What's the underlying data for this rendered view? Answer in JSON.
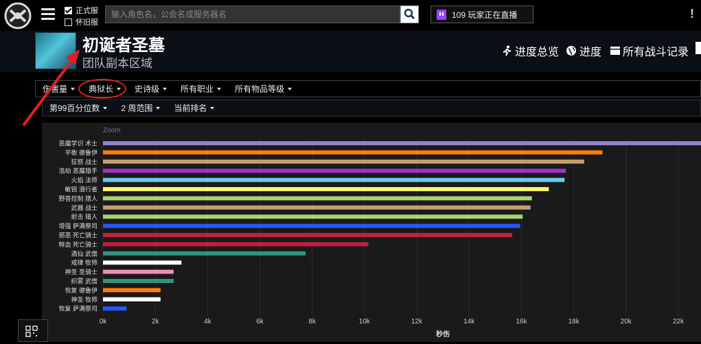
{
  "top": {
    "retail_label": "正式服",
    "classic_label": "怀旧服",
    "search_placeholder": "输入角色名，公会名或服务器名",
    "live_text": "109 玩家正在直播",
    "alert": "!"
  },
  "zone": {
    "title": "初诞者圣墓",
    "subtitle": "团队副本区域"
  },
  "nav": {
    "overview": "进度总览",
    "progress": "进度",
    "logs": "所有战斗记录"
  },
  "filters_row1": [
    "伤害量",
    "典狱长",
    "史诗级",
    "所有职业",
    "所有物品等级"
  ],
  "filters_row2": [
    "第99百分位数",
    "2 周范围",
    "当前排名"
  ],
  "colors": {
    "annotation": "#e02020"
  },
  "chart_data": {
    "type": "bar",
    "orientation": "horizontal",
    "zoom_label": "Zoom",
    "xlabel": "秒伤",
    "xlim": [
      0,
      23000
    ],
    "xticks": [
      0,
      2000,
      4000,
      6000,
      8000,
      10000,
      12000,
      14000,
      16000,
      18000,
      20000,
      22000
    ],
    "xtick_labels": [
      "0k",
      "2k",
      "4k",
      "6k",
      "8k",
      "10k",
      "12k",
      "14k",
      "16k",
      "18k",
      "20k",
      "22k"
    ],
    "categories": [
      "恶魔学识 术士",
      "平衡 德鲁伊",
      "狂怒 战士",
      "浩劫 恶魔猎手",
      "火焰 法师",
      "敏锐 潜行者",
      "野兽控制 猎人",
      "武器 战士",
      "射击 猎人",
      "增强 萨满祭司",
      "邪恶 死亡骑士",
      "鲜血 死亡骑士",
      "酒仙 武僧",
      "戒律 牧师",
      "神圣 圣骑士",
      "织雾 武僧",
      "恢复 德鲁伊",
      "神圣 牧师",
      "恢复 萨满祭司"
    ],
    "values": [
      23000,
      19100,
      18400,
      17700,
      17650,
      17050,
      16400,
      16350,
      16050,
      15950,
      15650,
      10150,
      7750,
      3000,
      2700,
      2700,
      2200,
      2200,
      900
    ],
    "bar_colors": [
      "#9482c9",
      "#ff7d0a",
      "#c79c6e",
      "#a330c9",
      "#69ccf0",
      "#fff569",
      "#abd473",
      "#c79c6e",
      "#abd473",
      "#2459ff",
      "#c41f3b",
      "#c41f3b",
      "#33937f",
      "#ffffff",
      "#f58cba",
      "#33937f",
      "#ff7d0a",
      "#ffffff",
      "#2459ff"
    ]
  }
}
